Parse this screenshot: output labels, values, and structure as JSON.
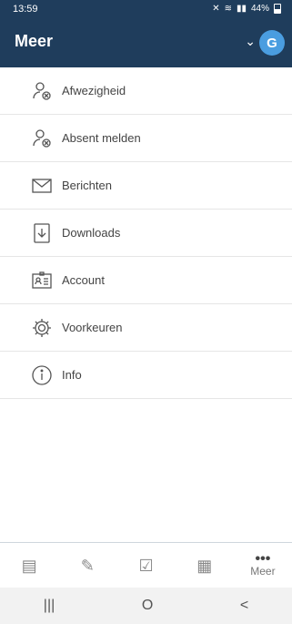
{
  "status": {
    "time": "13:59",
    "battery": "44%"
  },
  "header": {
    "title": "Meer",
    "avatar_initial": "G"
  },
  "menu": [
    {
      "label": "Afwezigheid",
      "icon": "person-absent-icon"
    },
    {
      "label": "Absent melden",
      "icon": "person-absent-report-icon"
    },
    {
      "label": "Berichten",
      "icon": "envelope-icon"
    },
    {
      "label": "Downloads",
      "icon": "download-icon"
    },
    {
      "label": "Account",
      "icon": "id-card-icon"
    },
    {
      "label": "Voorkeuren",
      "icon": "gear-icon"
    },
    {
      "label": "Info",
      "icon": "info-icon"
    }
  ],
  "tabbar": {
    "tabs": [
      {
        "icon": "calendar-icon"
      },
      {
        "icon": "pencil-icon"
      },
      {
        "icon": "checklist-icon"
      },
      {
        "icon": "grid-icon"
      },
      {
        "icon": "more-dots-icon",
        "label": "Meer",
        "dots": "•••"
      }
    ]
  },
  "navbar": {
    "recent": "|||",
    "home": "O",
    "back": "<"
  },
  "colors": {
    "header": "#1f3d5c",
    "avatar": "#4a9de0"
  }
}
